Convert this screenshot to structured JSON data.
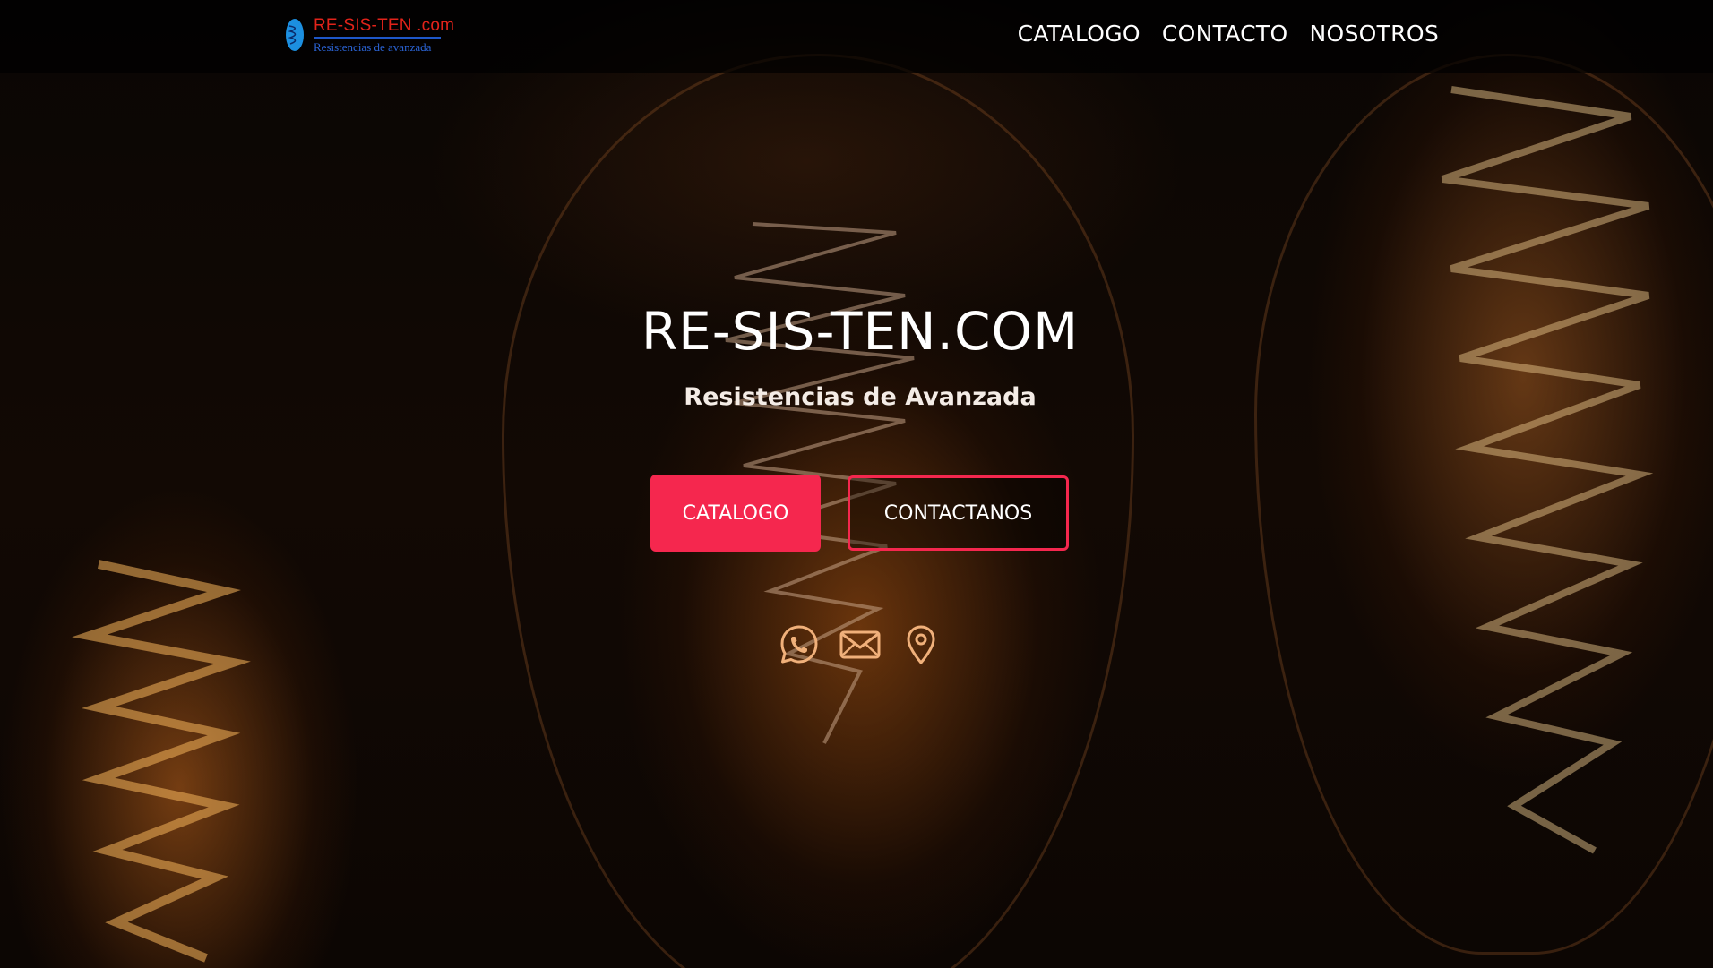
{
  "header": {
    "logo": {
      "main_text": "RE-SIS-TEN .com",
      "sub_text": "Resistencias de avanzada"
    },
    "nav": [
      {
        "label": "CATALOGO"
      },
      {
        "label": "CONTACTO"
      },
      {
        "label": "NOSOTROS"
      }
    ]
  },
  "hero": {
    "title": "RE-SIS-TEN.COM",
    "subtitle": "Resistencias de Avanzada",
    "primary_button": "CATALOGO",
    "secondary_button": "CONTACTANOS",
    "social_icons": [
      "whatsapp-icon",
      "mail-icon",
      "location-pin-icon"
    ]
  },
  "colors": {
    "accent": "#f5274e",
    "icon": "#f0b07a",
    "logo_red": "#e2231a",
    "logo_blue": "#2b64d6"
  }
}
